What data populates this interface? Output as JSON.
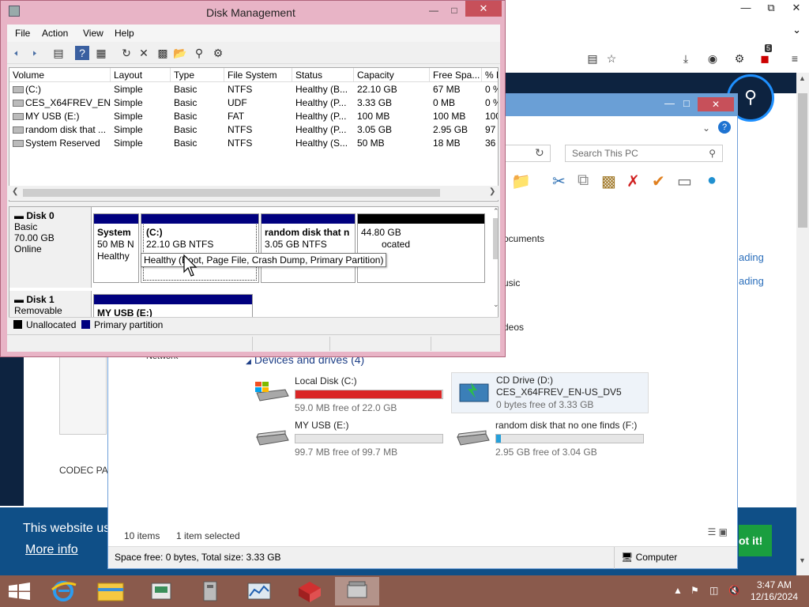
{
  "browser": {
    "window_controls": [
      "—",
      "⧉",
      "✕"
    ],
    "cookie_text": "This website us",
    "cookie_more": "More info",
    "cookie_button": "ot it!",
    "side_links": [
      "ading",
      "ading"
    ],
    "menu_items": [
      "CODEC PA"
    ],
    "badge": "5"
  },
  "explorer": {
    "search_placeholder": "Search This PC",
    "nav_items": [
      "ocuments",
      "usic",
      "deos"
    ],
    "network_label": "Network",
    "devices_header": "Devices and drives (4)",
    "drives": [
      {
        "name": "Local Disk (C:)",
        "free": "59.0 MB free of 22.0 GB",
        "used_fraction": 0.997,
        "bar_color": "#da2626"
      },
      {
        "name": "CD Drive (D:)",
        "subtitle": "CES_X64FREV_EN-US_DV5",
        "free": "0 bytes free of 3.33 GB",
        "selected": true
      },
      {
        "name": "MY USB (E:)",
        "free": "99.7 MB free of 99.7 MB",
        "used_fraction": 0.0,
        "bar_color": "#26a0da"
      },
      {
        "name": "random disk that no one finds (F:)",
        "free": "2.95 GB free of 3.04 GB",
        "used_fraction": 0.03,
        "bar_color": "#26a0da"
      }
    ],
    "status_items": "10 items",
    "status_selected": "1 item selected",
    "footer_space": "Space free: 0 bytes, Total size: 3.33 GB",
    "footer_location": "Computer"
  },
  "diskmgmt": {
    "title": "Disk Management",
    "menu": [
      "File",
      "Action",
      "View",
      "Help"
    ],
    "columns": [
      "Volume",
      "Layout",
      "Type",
      "File System",
      "Status",
      "Capacity",
      "Free Spa...",
      "% F"
    ],
    "volumes": [
      [
        "(C:)",
        "Simple",
        "Basic",
        "NTFS",
        "Healthy (B...",
        "22.10 GB",
        "67 MB",
        "0 %"
      ],
      [
        "CES_X64FREV_EN-...",
        "Simple",
        "Basic",
        "UDF",
        "Healthy (P...",
        "3.33 GB",
        "0 MB",
        "0 %"
      ],
      [
        "MY USB (E:)",
        "Simple",
        "Basic",
        "FAT",
        "Healthy (P...",
        "100 MB",
        "100 MB",
        "100"
      ],
      [
        "random disk that ...",
        "Simple",
        "Basic",
        "NTFS",
        "Healthy (P...",
        "3.05 GB",
        "2.95 GB",
        "97"
      ],
      [
        "System Reserved",
        "Simple",
        "Basic",
        "NTFS",
        "Healthy (S...",
        "50 MB",
        "18 MB",
        "36"
      ]
    ],
    "disk0": {
      "name": "Disk 0",
      "type": "Basic",
      "size": "70.00 GB",
      "state": "Online",
      "partitions": [
        {
          "name": "System",
          "size": "50 MB N",
          "status": "Healthy",
          "bar": "#00007f"
        },
        {
          "name": "(C:)",
          "size": "22.10 GB NTFS",
          "status": "Healthy (Boot, Page File, Crash Dump, Primary Partition)",
          "bar": "#00007f"
        },
        {
          "name": "random disk that n",
          "size": "3.05 GB NTFS",
          "status": "",
          "bar": "#00007f"
        },
        {
          "name": "",
          "size": "44.80 GB",
          "status": "ocated",
          "bar": "#000000"
        }
      ]
    },
    "disk1": {
      "name": "Disk 1",
      "type": "Removable",
      "partition_name": "MY USB  (E:)"
    },
    "tooltip": "Healthy (Boot, Page File, Crash Dump, Primary Partition)",
    "legend": [
      {
        "label": "Unallocated",
        "color": "#000000"
      },
      {
        "label": "Primary partition",
        "color": "#00007f"
      }
    ]
  },
  "taskbar": {
    "apps": [
      "Internet Explorer",
      "File Explorer",
      "App 3",
      "App 4",
      "App 5",
      "App 6",
      "Disk Management"
    ],
    "time": "3:47 AM",
    "date": "12/16/2024"
  }
}
